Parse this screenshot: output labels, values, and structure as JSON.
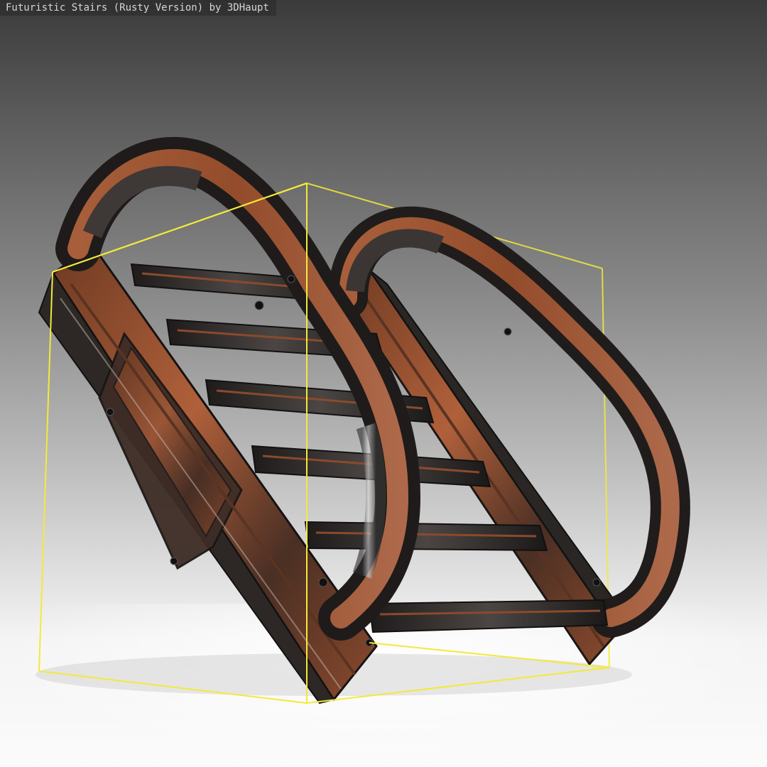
{
  "viewer": {
    "title": "Futuristic Stairs (Rusty Version) by 3DHaupt"
  },
  "scene": {
    "model_icon": "rusty-stairs-model",
    "bounding_box_color": "#f2ea3a",
    "rust_color": "#a8552e",
    "metal_color": "#2a2624"
  }
}
